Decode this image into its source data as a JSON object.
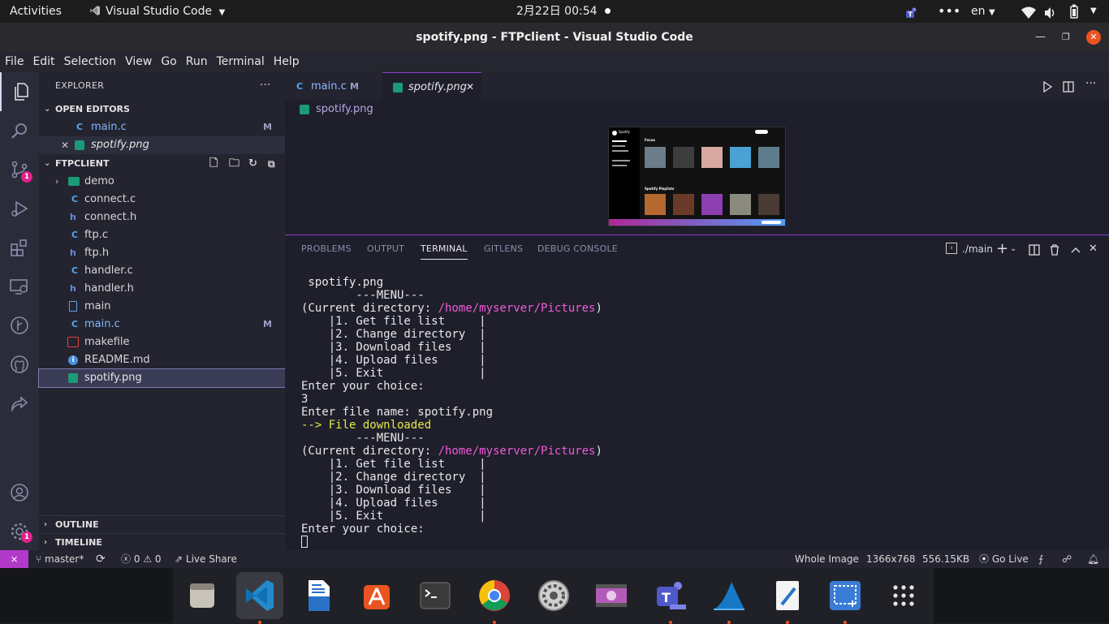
{
  "topbar": {
    "activities": "Activities",
    "app_name": "Visual Studio Code",
    "clock": "2月22日  00:54",
    "lang": "en"
  },
  "window": {
    "title": "spotify.png - FTPclient - Visual Studio Code"
  },
  "menu": [
    "File",
    "Edit",
    "Selection",
    "View",
    "Go",
    "Run",
    "Terminal",
    "Help"
  ],
  "activity_badges": {
    "source_control": "1",
    "manage": "1"
  },
  "explorer": {
    "title": "EXPLORER",
    "open_editors_title": "OPEN EDITORS",
    "open_editors": [
      {
        "icon": "C",
        "name": "main.c",
        "mark": "M"
      },
      {
        "icon": "img",
        "name": "spotify.png",
        "mark": ""
      }
    ],
    "project_title": "FTPCLIENT",
    "files": [
      {
        "icon": "folder",
        "name": "demo",
        "mark": ""
      },
      {
        "icon": "C",
        "name": "connect.c",
        "mark": ""
      },
      {
        "icon": "h",
        "name": "connect.h",
        "mark": ""
      },
      {
        "icon": "C",
        "name": "ftp.c",
        "mark": ""
      },
      {
        "icon": "h",
        "name": "ftp.h",
        "mark": ""
      },
      {
        "icon": "C",
        "name": "handler.c",
        "mark": ""
      },
      {
        "icon": "h",
        "name": "handler.h",
        "mark": ""
      },
      {
        "icon": "file",
        "name": "main",
        "mark": ""
      },
      {
        "icon": "C",
        "name": "main.c",
        "mark": "M"
      },
      {
        "icon": "make",
        "name": "makefile",
        "mark": ""
      },
      {
        "icon": "info",
        "name": "README.md",
        "mark": ""
      },
      {
        "icon": "img",
        "name": "spotify.png",
        "mark": ""
      }
    ],
    "outline_title": "OUTLINE",
    "timeline_title": "TIMELINE"
  },
  "tabs": [
    {
      "icon": "C",
      "label": "main.c",
      "mark": "M"
    },
    {
      "icon": "img",
      "label": "spotify.png",
      "mark": ""
    }
  ],
  "breadcrumb": "spotify.png",
  "panel": {
    "tabs": [
      "PROBLEMS",
      "OUTPUT",
      "TERMINAL",
      "GITLENS",
      "DEBUG CONSOLE"
    ],
    "terminal_name": "./main"
  },
  "terminal": {
    "lines": [
      " spotify.png",
      "        ---MENU---",
      "(Current directory: |/home/myserver/Pictures|)",
      "    |1. Get file list     |",
      "    |2. Change directory  |",
      "    |3. Download files    |",
      "    |4. Upload files      |",
      "    |5. Exit              |",
      "Enter your choice:",
      "3",
      "Enter file name: spotify.png",
      "--> File downloaded",
      "        ---MENU---",
      "(Current directory: |/home/myserver/Pictures|)",
      "    |1. Get file list     |",
      "    |2. Change directory  |",
      "    |3. Download files    |",
      "    |4. Upload files      |",
      "    |5. Exit              |",
      "Enter your choice:"
    ],
    "path": "/home/myserver/Pictures",
    "dir_prefix": "(Current directory: ",
    "dir_suffix": ")",
    "download_msg": "--> File downloaded"
  },
  "statusbar": {
    "branch": "master*",
    "errors": "0",
    "warnings": "0",
    "live_share": "Live Share",
    "image_scope": "Whole Image",
    "dimensions": "1366x768",
    "file_size": "556.15KB",
    "go_live": "Go Live"
  },
  "preview_image": {
    "app": "Spotify",
    "section1": "Focus",
    "section2": "Spotify Playlists"
  }
}
